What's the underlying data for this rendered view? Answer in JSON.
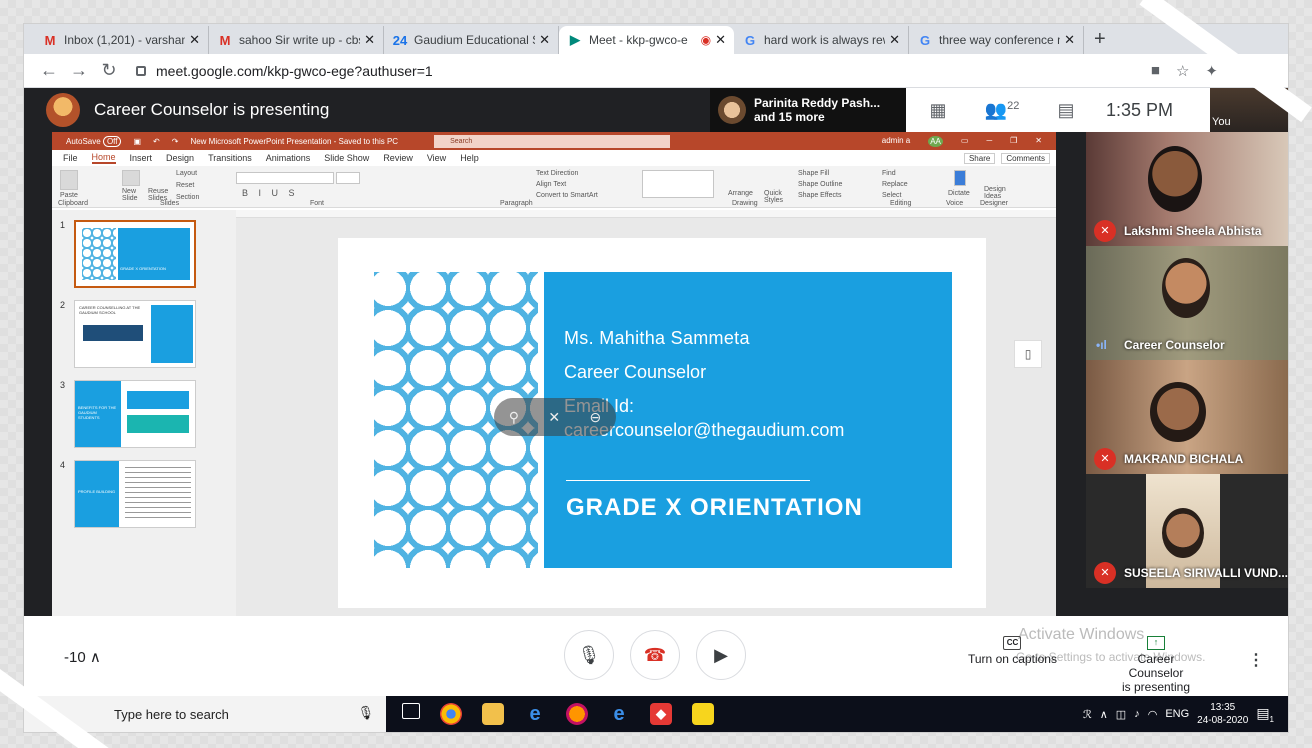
{
  "browser": {
    "tabs": [
      {
        "icon": "gmail-icon",
        "letter": "M",
        "color": "#d93025",
        "title": "Inbox (1,201) - varshanc"
      },
      {
        "icon": "gmail-icon",
        "letter": "M",
        "color": "#d93025",
        "title": "sahoo Sir write up - cbs"
      },
      {
        "icon": "calendar-icon",
        "letter": "24",
        "color": "#1a73e8",
        "title": "Gaudium Educational S"
      },
      {
        "icon": "meet-icon",
        "letter": "▶",
        "color": "#00897b",
        "title": "Meet - kkp-gwco-e"
      },
      {
        "icon": "google-icon",
        "letter": "G",
        "color": "#4285f4",
        "title": "hard work is always rew"
      },
      {
        "icon": "google-icon",
        "letter": "G",
        "color": "#4285f4",
        "title": "three way conference m"
      }
    ],
    "close_glyph": "✕",
    "new_tab": "+",
    "url": "meet.google.com/kkp-gwco-ege?authuser=1"
  },
  "meet": {
    "presenting_text": "Career Counselor is presenting",
    "participants_name": "Parinita Reddy Pash...",
    "participants_more": "and 15 more",
    "people_count": "22",
    "time": "1:35 PM",
    "you_label": "You",
    "tiles": [
      {
        "name": "Lakshmi Sheela Abhista",
        "muted": true
      },
      {
        "name": "Career Counselor",
        "muted": false
      },
      {
        "name": "MAKRAND BICHALA",
        "muted": true
      },
      {
        "name": "SUSEELA SIRIVALLI VUND...",
        "muted": true
      }
    ],
    "bottom": {
      "left_text": "-10",
      "captions": "Turn on captions",
      "cc": "CC",
      "presenting_line1": "Career Counselor",
      "presenting_line2": "is presenting",
      "watermark1": "Activate Windows",
      "watermark2": "Go to Settings to activate Windows."
    }
  },
  "ppt": {
    "autosave": "AutoSave",
    "autosave_state": "Off",
    "doc_title": "New Microsoft PowerPoint Presentation - Saved to this PC",
    "search": "Search",
    "user": "admin a",
    "user_initials": "AA",
    "menus": [
      "File",
      "Home",
      "Insert",
      "Design",
      "Transitions",
      "Animations",
      "Slide Show",
      "Review",
      "View",
      "Help"
    ],
    "share": "Share",
    "comments": "Comments",
    "groups": [
      "Clipboard",
      "Slides",
      "Font",
      "Paragraph",
      "Drawing",
      "Editing",
      "Voice",
      "Designer"
    ],
    "ribbon": {
      "paste": "Paste",
      "new_slide": "New Slide",
      "reuse": "Reuse Slides",
      "layout": "Layout",
      "reset": "Reset",
      "section": "Section",
      "text_direction": "Text Direction",
      "align_text": "Align Text",
      "smartart": "Convert to SmartArt",
      "arrange": "Arrange",
      "quick_styles": "Quick Styles",
      "shape_fill": "Shape Fill",
      "shape_outline": "Shape Outline",
      "shape_effects": "Shape Effects",
      "find": "Find",
      "replace": "Replace",
      "select": "Select",
      "dictate": "Dictate",
      "design_ideas": "Design Ideas"
    },
    "thumbnails": [
      {
        "num": "1",
        "text": "GRADE X ORIENTATION"
      },
      {
        "num": "2",
        "text": "CAREER COUNSELLING AT THE GAUDIUM SCHOOL"
      },
      {
        "num": "3",
        "text": "BENEFITS FOR THE GAUDIUM STUDENTS"
      },
      {
        "num": "4",
        "text": "PROFILE BUILDING"
      }
    ],
    "slide": {
      "line1": "Ms. Mahitha Sammeta",
      "line2": "Career Counselor",
      "line3": "Email Id:",
      "line4": "careercounselor@thegaudium.com",
      "grade": "GRADE X ORIENTATION"
    }
  },
  "taskbar": {
    "search": "Type here to search",
    "lang": "ENG",
    "time": "13:35",
    "date": "24-08-2020",
    "notif_count": "1"
  }
}
